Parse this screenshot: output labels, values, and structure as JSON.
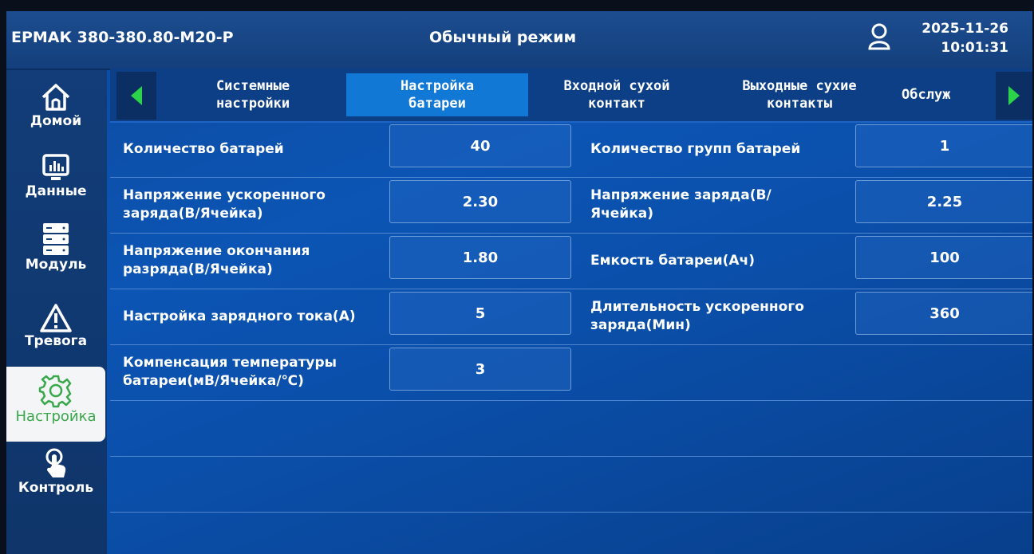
{
  "header": {
    "model": "ЕРМАК 380-380.80-М20-Р",
    "mode": "Обычный режим",
    "date": "2025-11-26",
    "time": "10:01:31"
  },
  "sidebar": {
    "items": [
      {
        "label": "Домой",
        "icon": "home-icon"
      },
      {
        "label": "Данные",
        "icon": "data-chart-icon"
      },
      {
        "label": "Модуль",
        "icon": "server-module-icon"
      },
      {
        "label": "Тревога",
        "icon": "alarm-warning-icon"
      },
      {
        "label": "Настройка",
        "icon": "gear-icon",
        "active": true
      },
      {
        "label": "Контроль",
        "icon": "touch-control-icon"
      }
    ]
  },
  "tabs": [
    {
      "line1": "Системные",
      "line2": "настройки"
    },
    {
      "line1": "Настройка",
      "line2": "батареи",
      "active": true
    },
    {
      "line1": "Входной сухой",
      "line2": "контакт"
    },
    {
      "line1": "Выходные сухие",
      "line2": "контакты"
    },
    {
      "line1": "Обслуж",
      "line2": ""
    }
  ],
  "settings": {
    "battery_count": {
      "label": "Количество батарей",
      "value": "40"
    },
    "battery_groups": {
      "label": "Количество групп батарей",
      "value": "1"
    },
    "boost_voltage": {
      "label1": "Напряжение ускоренного",
      "label2": "заряда(В/Ячейка)",
      "value": "2.30"
    },
    "charge_voltage": {
      "label1": "Напряжение заряда(В/",
      "label2": "Ячейка)",
      "value": "2.25"
    },
    "end_discharge_voltage": {
      "label1": "Напряжение окончания",
      "label2": "разряда(В/Ячейка)",
      "value": "1.80"
    },
    "battery_capacity": {
      "label": "Емкость батареи(Ач)",
      "value": "100"
    },
    "charge_current": {
      "label": "Настройка зарядного тока(А)",
      "value": "5"
    },
    "boost_duration": {
      "label1": "Длительность ускоренного",
      "label2": "заряда(Мин)",
      "value": "360"
    },
    "temp_compensation": {
      "label1": "Компенсация температуры",
      "label2": "батареи(мВ/Ячейка/℃)",
      "value": "3"
    }
  },
  "colors": {
    "accent_green": "#39a84b",
    "tab_active": "#1278d6",
    "background_blue": "#0c55b4"
  }
}
